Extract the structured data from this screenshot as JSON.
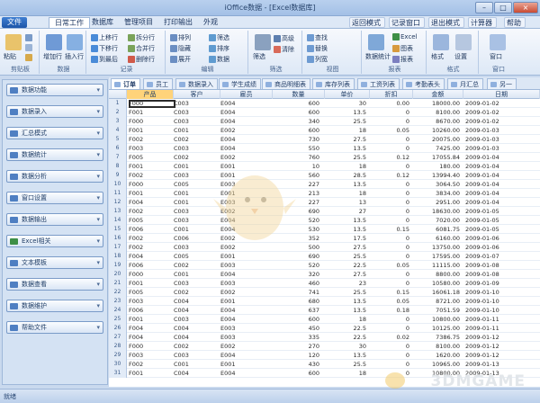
{
  "window": {
    "title": "iOffice数据 - [Excel数据库]"
  },
  "menubar": {
    "file": "文件",
    "tabs": [
      "日常工作",
      "数据库",
      "管理项目",
      "打印输出",
      "外观"
    ],
    "quick": [
      "返回模式",
      "记录窗口",
      "退出模式",
      "计算器",
      "帮助"
    ]
  },
  "ribbon": {
    "groups": [
      {
        "name": "剪贴板",
        "buttons": [
          "粘贴",
          "剪切",
          "复制",
          "格式"
        ]
      },
      {
        "name": "数据",
        "buttons": [
          "增加行",
          "插入行"
        ]
      },
      {
        "name": "记录",
        "buttons": [
          "上移行",
          "下移行",
          "到最后",
          "拆分行",
          "合并行",
          "删除行"
        ]
      },
      {
        "name": "编辑",
        "buttons": [
          "排列",
          "隐藏",
          "展开",
          "筛选",
          "排序",
          "数据"
        ]
      },
      {
        "name": "筛选",
        "buttons": [
          "筛选",
          "高级",
          "清除"
        ]
      },
      {
        "name": "视图",
        "buttons": [
          "查找",
          "替换",
          "列宽"
        ]
      },
      {
        "name": "报表",
        "buttons": [
          "数据统计",
          "Excel",
          "图表",
          "报表"
        ]
      },
      {
        "name": "格式",
        "buttons": [
          "格式",
          "设置"
        ]
      },
      {
        "name": "窗口",
        "buttons": [
          "窗口"
        ]
      }
    ]
  },
  "sidebar": {
    "items": [
      "数据功能",
      "数据录入",
      "汇总模式",
      "数据统计",
      "数据分析",
      "窗口设置",
      "数据输出",
      "Excel相关",
      "文本模板",
      "数据查看",
      "数据维护",
      "帮助文件"
    ]
  },
  "sheet_tabs": [
    "订单",
    "员工",
    "数据录入",
    "学生成绩",
    "商品明细表",
    "库存列表",
    "工资列表",
    "考勤表头",
    "月汇总",
    "另一"
  ],
  "grid": {
    "columns": [
      "产品",
      "客户",
      "雇员",
      "数量",
      "单价",
      "折扣",
      "金额",
      "日期"
    ],
    "rows": [
      [
        "F000",
        "C003",
        "E004",
        "600",
        "30",
        "0.00",
        "18000.00",
        "2009-01-02"
      ],
      [
        "F001",
        "C003",
        "E004",
        "600",
        "13.5",
        "0",
        "8100.00",
        "2009-01-02"
      ],
      [
        "F000",
        "C003",
        "E004",
        "340",
        "25.5",
        "0",
        "8670.00",
        "2009-01-02"
      ],
      [
        "F001",
        "C001",
        "E002",
        "600",
        "18",
        "0.05",
        "10260.00",
        "2009-01-03"
      ],
      [
        "F002",
        "C002",
        "E004",
        "730",
        "27.5",
        "0",
        "20075.00",
        "2009-01-03"
      ],
      [
        "F003",
        "C003",
        "E004",
        "550",
        "13.5",
        "0",
        "7425.00",
        "2009-01-03"
      ],
      [
        "F005",
        "C002",
        "E002",
        "760",
        "25.5",
        "0.12",
        "17055.84",
        "2009-01-04"
      ],
      [
        "F001",
        "C001",
        "E001",
        "10",
        "18",
        "0",
        "180.00",
        "2009-01-04"
      ],
      [
        "F002",
        "C003",
        "E001",
        "560",
        "28.5",
        "0.12",
        "13994.40",
        "2009-01-04"
      ],
      [
        "F000",
        "C005",
        "E003",
        "227",
        "13.5",
        "0",
        "3064.50",
        "2009-01-04"
      ],
      [
        "F001",
        "C001",
        "E001",
        "213",
        "18",
        "0",
        "3834.00",
        "2009-01-04"
      ],
      [
        "F004",
        "C001",
        "E003",
        "227",
        "13",
        "0",
        "2951.00",
        "2009-01-04"
      ],
      [
        "F002",
        "C003",
        "E002",
        "690",
        "27",
        "0",
        "18630.00",
        "2009-01-05"
      ],
      [
        "F005",
        "C003",
        "E004",
        "520",
        "13.5",
        "0",
        "7020.00",
        "2009-01-05"
      ],
      [
        "F006",
        "C001",
        "E004",
        "530",
        "13.5",
        "0.15",
        "6081.75",
        "2009-01-05"
      ],
      [
        "F002",
        "C006",
        "E002",
        "352",
        "17.5",
        "0",
        "6160.00",
        "2009-01-06"
      ],
      [
        "F002",
        "C003",
        "E002",
        "500",
        "27.5",
        "0",
        "13750.00",
        "2009-01-06"
      ],
      [
        "F004",
        "C005",
        "E001",
        "690",
        "25.5",
        "0",
        "17595.00",
        "2009-01-07"
      ],
      [
        "F006",
        "C002",
        "E003",
        "520",
        "22.5",
        "0.05",
        "11115.00",
        "2009-01-08"
      ],
      [
        "F000",
        "C001",
        "E004",
        "320",
        "27.5",
        "0",
        "8800.00",
        "2009-01-08"
      ],
      [
        "F001",
        "C003",
        "E003",
        "460",
        "23",
        "0",
        "10580.00",
        "2009-01-09"
      ],
      [
        "F005",
        "C002",
        "E002",
        "741",
        "25.5",
        "0.15",
        "16061.18",
        "2009-01-10"
      ],
      [
        "F003",
        "C004",
        "E001",
        "680",
        "13.5",
        "0.05",
        "8721.00",
        "2009-01-10"
      ],
      [
        "F006",
        "C004",
        "E004",
        "637",
        "13.5",
        "0.18",
        "7051.59",
        "2009-01-10"
      ],
      [
        "F001",
        "C003",
        "E004",
        "600",
        "18",
        "0",
        "10800.00",
        "2009-01-11"
      ],
      [
        "F004",
        "C004",
        "E003",
        "450",
        "22.5",
        "0",
        "10125.00",
        "2009-01-11"
      ],
      [
        "F004",
        "C004",
        "E003",
        "335",
        "22.5",
        "0.02",
        "7386.75",
        "2009-01-12"
      ],
      [
        "F000",
        "C002",
        "E002",
        "270",
        "30",
        "0",
        "8100.00",
        "2009-01-12"
      ],
      [
        "F003",
        "C003",
        "E004",
        "120",
        "13.5",
        "0",
        "1620.00",
        "2009-01-12"
      ],
      [
        "F002",
        "C001",
        "E001",
        "430",
        "25.5",
        "0",
        "10965.00",
        "2009-01-13"
      ],
      [
        "F001",
        "C004",
        "E004",
        "600",
        "18",
        "0",
        "10800.00",
        "2009-01-13"
      ]
    ]
  },
  "status": {
    "text": "就绪"
  },
  "watermark": {
    "text": "3DMGAME"
  },
  "colors": {
    "accent": "#1e56a8",
    "header": "#dbe6f4",
    "selected": "#ffd37a"
  }
}
